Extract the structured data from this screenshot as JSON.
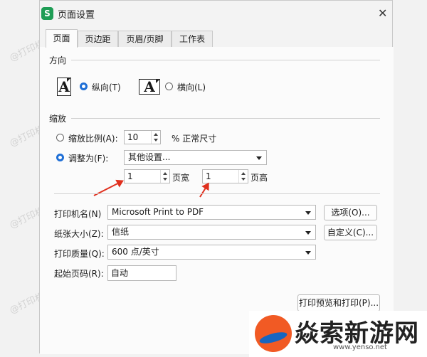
{
  "dialog": {
    "title": "页面设置",
    "app_icon_letter": "S"
  },
  "tabs": [
    "页面",
    "页边距",
    "页眉/页脚",
    "工作表"
  ],
  "orientation": {
    "label": "方向",
    "portrait_label": "纵向(T)",
    "landscape_label": "横向(L)",
    "selected": "portrait",
    "icon_glyph": "A"
  },
  "scaling": {
    "label": "缩放",
    "scale_label": "缩放比例(A):",
    "scale_value": "10",
    "scale_suffix": "% 正常尺寸",
    "fit_label": "调整为(F):",
    "fit_option": "其他设置...",
    "pages_wide_value": "1",
    "pages_wide_label": "页宽",
    "pages_tall_value": "1",
    "pages_tall_label": "页高",
    "selected": "fit"
  },
  "printer": {
    "name_label": "打印机名(N)",
    "name_value": "Microsoft Print to PDF",
    "options_button": "选项(O)...",
    "paper_label": "纸张大小(Z):",
    "paper_value": "信纸",
    "custom_button": "自定义(C)...",
    "quality_label": "打印质量(Q):",
    "quality_value": "600 点/英寸",
    "start_page_label": "起始页码(R):",
    "start_page_value": "自动"
  },
  "preview_button": "打印预览和打印(P)...",
  "watermark": "@打印机卫士",
  "logo": {
    "text": "焱索新游网",
    "url": "www.yenso.net"
  },
  "colors": {
    "accent": "#1f6fd6",
    "arrow": "#e0301e",
    "brand_green": "#1f9d55"
  }
}
